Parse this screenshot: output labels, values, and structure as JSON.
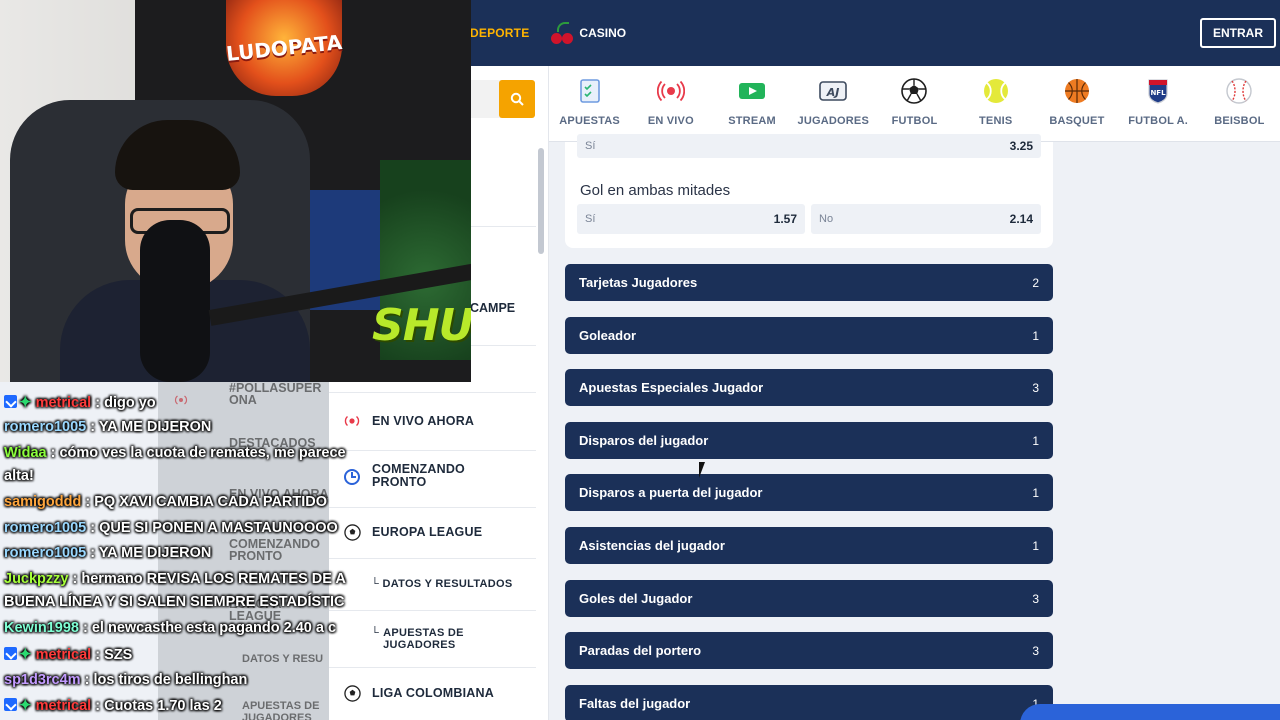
{
  "header": {
    "nav_deporte": "DEPORTE",
    "nav_casino": "CASINO",
    "login_button": "ENTRAR"
  },
  "sports": [
    {
      "label": "APUESTAS",
      "icon": "ticket-icon"
    },
    {
      "label": "EN VIVO",
      "icon": "live-icon"
    },
    {
      "label": "STREAM",
      "icon": "stream-icon"
    },
    {
      "label": "JUGADORES",
      "icon": "players-icon"
    },
    {
      "label": "FUTBOL",
      "icon": "soccer-ball-icon"
    },
    {
      "label": "TENIS",
      "icon": "tennis-ball-icon"
    },
    {
      "label": "BASQUET",
      "icon": "basketball-icon"
    },
    {
      "label": "FUTBOL A.",
      "icon": "nfl-icon"
    },
    {
      "label": "BEISBOL",
      "icon": "baseball-icon"
    }
  ],
  "sidebar": {
    "partial_text": "CAMPE",
    "items": [
      {
        "label": "EN VIVO AHORA",
        "icon": "live-icon"
      },
      {
        "label": "COMENZANDO PRONTO",
        "icon": "clock-icon"
      },
      {
        "label": "EUROPA LEAGUE",
        "icon": "soccer-ball-icon"
      },
      {
        "label": "LIGA COLOMBIANA",
        "icon": "soccer-ball-icon"
      }
    ],
    "subitems": [
      {
        "label": "DATOS Y RESULTADOS"
      },
      {
        "label": "APUESTAS DE JUGADORES"
      }
    ]
  },
  "market_panel": {
    "top_row": {
      "left_label": "Sí",
      "left_value": "3.25"
    },
    "title": "Gol en ambas mitades",
    "options": [
      {
        "label": "Sí",
        "value": "1.57"
      },
      {
        "label": "No",
        "value": "2.14"
      }
    ]
  },
  "markets": [
    {
      "label": "Tarjetas Jugadores",
      "count": "2"
    },
    {
      "label": "Goleador",
      "count": "1"
    },
    {
      "label": "Apuestas Especiales Jugador",
      "count": "3"
    },
    {
      "label": "Disparos del jugador",
      "count": "1"
    },
    {
      "label": "Disparos a puerta del jugador",
      "count": "1"
    },
    {
      "label": "Asistencias del jugador",
      "count": "1"
    },
    {
      "label": "Goles del Jugador",
      "count": "3"
    },
    {
      "label": "Paradas del portero",
      "count": "3"
    },
    {
      "label": "Faltas del jugador",
      "count": "1"
    }
  ],
  "stream_overlay": {
    "logo_text": "LUDOPATA",
    "banner_text": "SHU",
    "ghost_labels": [
      "#POLLASUPER ONA",
      "DESTACADOS",
      "EN VIVO AHORA",
      "COMENZANDO PRONTO",
      "EUROPA LEAGUE",
      "DATOS Y RESU",
      "APUESTAS DE JUGADORES"
    ],
    "chat": [
      {
        "user": "metrical",
        "text": ": digo yo",
        "color": "#ff3b3b",
        "badges": true
      },
      {
        "user": "romero1005",
        "text": ": YA ME DIJERON",
        "color": "#9ad8ff",
        "badges": false
      },
      {
        "user": "Widaa",
        "text": ": cómo ves la cuota de remates, me parece",
        "color": "#8cff3c",
        "badges": false
      },
      {
        "user": "",
        "text": "alta!",
        "color": "#ffffff",
        "badges": false
      },
      {
        "user": "samigoddd",
        "text": ": PQ XAVI CAMBIA CADA PARTIDO",
        "color": "#ffa63d",
        "badges": false
      },
      {
        "user": "romero1005",
        "text": ": QUE SI PONEN A MASTAUNOOOO",
        "color": "#9ad8ff",
        "badges": false
      },
      {
        "user": "romero1005",
        "text": ": YA ME DIJERON",
        "color": "#9ad8ff",
        "badges": false
      },
      {
        "user": "Juckpzzy",
        "text": ": hermano REVISA LOS REMATES DE A",
        "color": "#a6ff3a",
        "badges": false
      },
      {
        "user": "",
        "text": "BUENA LÍNEA Y SI SALEN SIEMPRE ESTADÍSTIC",
        "color": "#ffffff",
        "badges": false
      },
      {
        "user": "Kewin1998",
        "text": ": el newcasthe esta pagando 2.40 a c",
        "color": "#7fffd4",
        "badges": false
      },
      {
        "user": "metrical",
        "text": ": SZS",
        "color": "#ff3b3b",
        "badges": true
      },
      {
        "user": "sp1d3rc4m",
        "text": ": los tiros de bellinghan",
        "color": "#c39bff",
        "badges": false
      },
      {
        "user": "metrical",
        "text": ": Cuotas 1.70 las 2",
        "color": "#ff3b3b",
        "badges": true
      }
    ]
  },
  "colors": {
    "navy": "#1b3058",
    "accent": "#f5a300",
    "page_bg": "#eef1f6"
  }
}
